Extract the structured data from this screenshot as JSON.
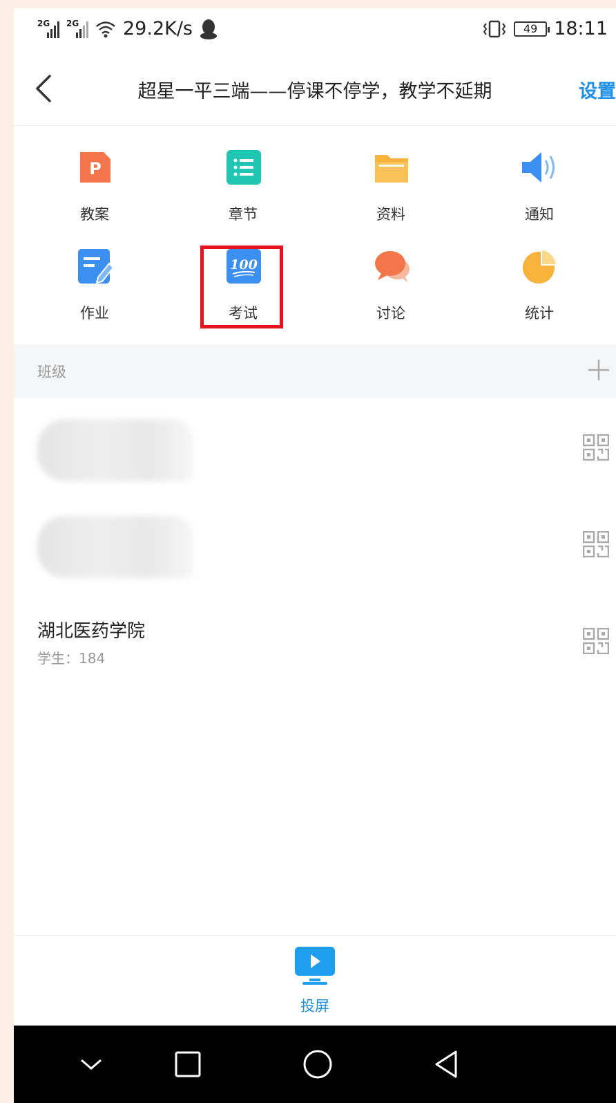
{
  "status_bar": {
    "signal1": "2G",
    "signal2": "2G",
    "speed": "29.2K/s",
    "battery": "49",
    "time": "18:11"
  },
  "header": {
    "title": "超星一平三端——停课不停学，教学不延期",
    "settings": "设置"
  },
  "features": [
    {
      "label": "教案",
      "icon": "ppt-icon",
      "color": "#f2764a"
    },
    {
      "label": "章节",
      "icon": "list-icon",
      "color": "#21c6b3"
    },
    {
      "label": "资料",
      "icon": "folder-icon",
      "color": "#f7b33c"
    },
    {
      "label": "通知",
      "icon": "speaker-icon",
      "color": "#3b8ff0"
    },
    {
      "label": "作业",
      "icon": "edit-icon",
      "color": "#3b8ff0"
    },
    {
      "label": "考试",
      "icon": "exam-100-icon",
      "color": "#3b8ff0"
    },
    {
      "label": "讨论",
      "icon": "chat-bubbles-icon",
      "color": "#f2764a"
    },
    {
      "label": "统计",
      "icon": "pie-chart-icon",
      "color": "#f7b33c"
    }
  ],
  "class_section": {
    "label": "班级",
    "rows": [
      {
        "name": "",
        "sub": "",
        "blurred": true
      },
      {
        "name": "",
        "sub": "",
        "blurred": true
      },
      {
        "name": "湖北医药学院",
        "sub": "学生：184",
        "blurred": false
      }
    ]
  },
  "tabbar": {
    "cast_label": "投屏"
  },
  "colors": {
    "accent": "#1f8fe8",
    "highlight": "#e8131a"
  }
}
